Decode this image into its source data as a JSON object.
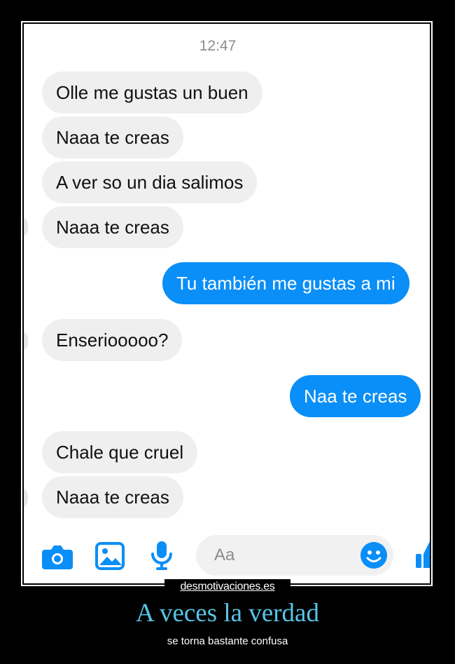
{
  "chat": {
    "time": "12:47",
    "messages": [
      {
        "side": "in",
        "text": "Olle me gustas un buen"
      },
      {
        "side": "in",
        "text": "Naaa te creas"
      },
      {
        "side": "in",
        "text": "A ver so un dia salimos"
      },
      {
        "side": "in",
        "text": "Naaa te creas"
      },
      {
        "side": "out",
        "text": "Tu también me gustas a mi"
      },
      {
        "side": "in",
        "text": "Enseriooooo?"
      },
      {
        "side": "out",
        "text": "Naa te creas"
      },
      {
        "side": "in",
        "text": "Chale que cruel"
      },
      {
        "side": "in",
        "text": "Naaa te creas"
      }
    ],
    "composer": {
      "placeholder": "Aa"
    }
  },
  "colors": {
    "outgoing_bubble": "#0a8ef7",
    "incoming_bubble": "#efefef",
    "icon_blue": "#0a8ef7",
    "caption_title": "#56c6e8"
  },
  "icons": [
    "camera-icon",
    "image-icon",
    "microphone-icon",
    "emoji-icon",
    "thumbs-up-icon"
  ],
  "poster": {
    "watermark": "desmotivaciones.es",
    "title": "A veces la verdad",
    "subtitle": "se torna bastante confusa"
  }
}
